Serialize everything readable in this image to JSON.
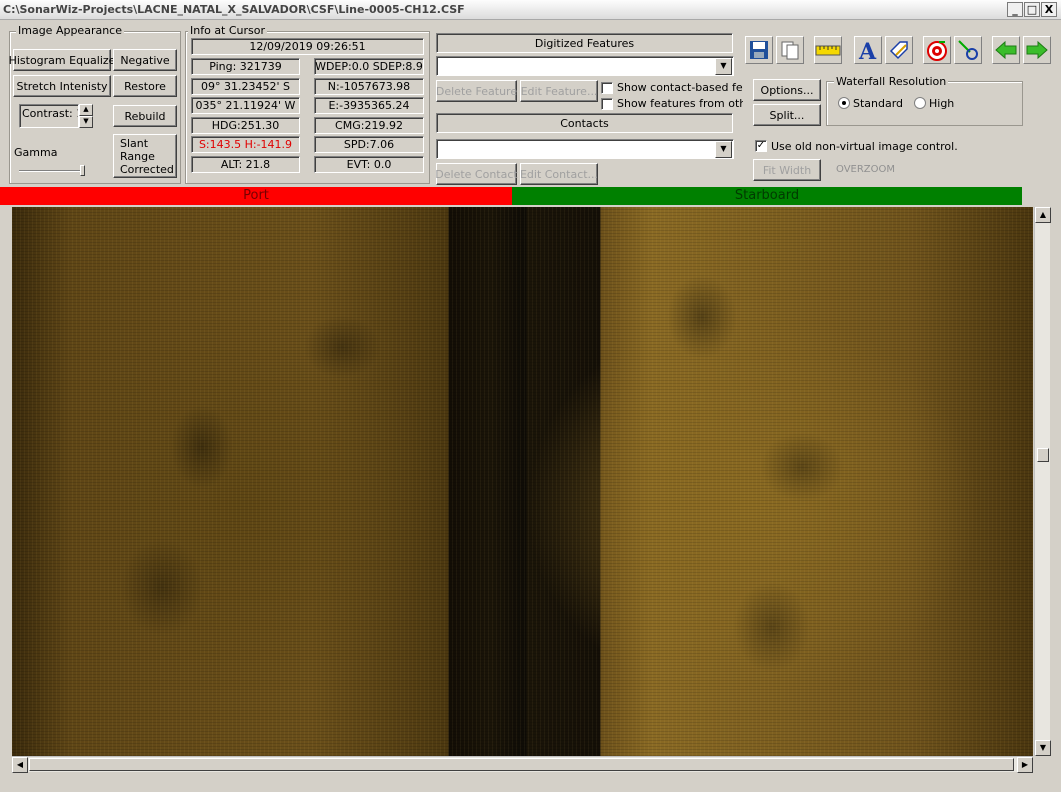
{
  "window": {
    "title": "C:\\SonarWiz-Projects\\LACNE_NATAL_X_SALVADOR\\CSF\\Line-0005-CH12.CSF",
    "min": "_",
    "max": "□",
    "close": "X"
  },
  "appearance": {
    "group_label": "Image Appearance",
    "histogram_equalize": "Histogram Equalize",
    "negative": "Negative",
    "stretch_intensity": "Stretch Intenisty",
    "restore": "Restore",
    "contrast": "Contrast: 1",
    "rebuild": "Rebuild",
    "gamma": "Gamma",
    "slant_range": "Slant Range Corrected"
  },
  "cursor_info": {
    "group_label": "Info at Cursor",
    "datetime": "12/09/2019 09:26:51",
    "ping": "Ping: 321739",
    "wdep": "WDEP:0.0 SDEP:8.9",
    "lat": "09° 31.23452' S",
    "northing": "N:-1057673.98",
    "lon": "035° 21.11924' W",
    "easting": "E:-3935365.24",
    "hdg": "HDG:251.30",
    "cmg": "CMG:219.92",
    "sh": "S:143.5 H:-141.9",
    "spd": "SPD:7.06",
    "alt": "ALT: 21.8",
    "evt": "EVT: 0.0"
  },
  "features": {
    "header": "Digitized Features",
    "delete_feature": "Delete Feature",
    "edit_feature": "Edit Feature...",
    "show_contact_based": "Show contact-based featu",
    "show_features_other": "Show features from other",
    "contacts_header": "Contacts",
    "delete_contact": "Delete Contact",
    "edit_contact": "Edit Contact..."
  },
  "options": {
    "options_btn": "Options...",
    "split_btn": "Split...",
    "waterfall_label": "Waterfall Resolution",
    "standard": "Standard",
    "high": "High",
    "use_old": "Use old non-virtual image control.",
    "fit_width": "Fit Width",
    "overzoom": "OVERZOOM"
  },
  "channels": {
    "port": "Port",
    "starboard": "Starboard",
    "port_color": "#ff0000",
    "starboard_color": "#008000"
  },
  "colors": {
    "sonar_base": "#6a4f1a",
    "nadir": "#120d05"
  }
}
